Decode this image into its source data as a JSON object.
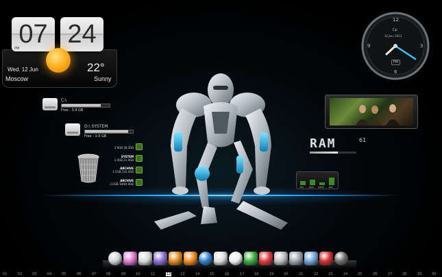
{
  "clock_widget": {
    "hour": "07",
    "minute": "24",
    "ampm": "PM",
    "date": "Wed. 12 Jun",
    "city": "Moscow",
    "temperature": "22°",
    "condition": "Sunny"
  },
  "drives": [
    {
      "label": "C:\\",
      "free_text": "Free :  3.9 GB",
      "fill": 0.82
    },
    {
      "label": "D:\\ SYSTEM",
      "free_text": "Free :  1.0 GB",
      "fill": 0.9
    }
  ],
  "disk_stats": [
    {
      "value": "3.9GB 28.3GB",
      "name": ""
    },
    {
      "name": "SYSTEM",
      "value": "1.0GB 21.0GB"
    },
    {
      "name": "ARCHIVE",
      "value": "1.5GB 110.4GB"
    },
    {
      "name": "ARCHIVE",
      "value": "2.0GB 1HHH.9GB"
    }
  ],
  "analog_clock": {
    "numbers": [
      "12",
      "3",
      "6",
      "9"
    ],
    "label": "Cp",
    "date": "12 Jun, 2013",
    "ampm": "PM"
  },
  "ram_widget": {
    "word": "RAM",
    "value": "61",
    "fill": 0.61
  },
  "system_meter": {
    "labels": [
      "CPU",
      "RAM",
      "SWAP",
      "BAT"
    ],
    "levels": [
      0.45,
      0.6,
      0.3,
      0.8
    ]
  },
  "dock": {
    "icons": [
      {
        "name": "clock-icon",
        "color": "#cfcfcf"
      },
      {
        "name": "gamepad-icon",
        "color": "#e07ad2"
      },
      {
        "name": "printer-icon",
        "color": "#d9d9d9"
      },
      {
        "name": "pen-icon",
        "color": "#8a6fd6"
      },
      {
        "name": "media-player-icon",
        "color": "#e08a1f"
      },
      {
        "name": "rss-icon",
        "color": "#f08a1f"
      },
      {
        "name": "globe-icon",
        "color": "#2f7fd0"
      },
      {
        "name": "download-icon",
        "color": "#dcdcdc"
      },
      {
        "name": "soccer-ball-icon",
        "color": "#eeeeee"
      },
      {
        "name": "rubiks-cube-icon",
        "color": "#3cae3c"
      },
      {
        "name": "paint-bucket-icon",
        "color": "#e03a3a"
      },
      {
        "name": "chat-icon",
        "color": "#bdbdbd"
      },
      {
        "name": "usb-drive-icon",
        "color": "#9aa3ad"
      },
      {
        "name": "laptop-icon",
        "color": "#6fa8dc"
      },
      {
        "name": "puzzle-icon",
        "color": "#d03030"
      },
      {
        "name": "power-icon",
        "color": "#6a6a6a"
      }
    ]
  },
  "timeline": {
    "days": [
      "01",
      "02",
      "03",
      "04",
      "05",
      "06",
      "07",
      "08",
      "09",
      "10",
      "11",
      "12",
      "13",
      "14",
      "15",
      "16",
      "17",
      "18",
      "19",
      "20",
      "21",
      "22",
      "23",
      "24",
      "25",
      "26",
      "27",
      "28",
      "29",
      "30"
    ],
    "current": "12"
  }
}
